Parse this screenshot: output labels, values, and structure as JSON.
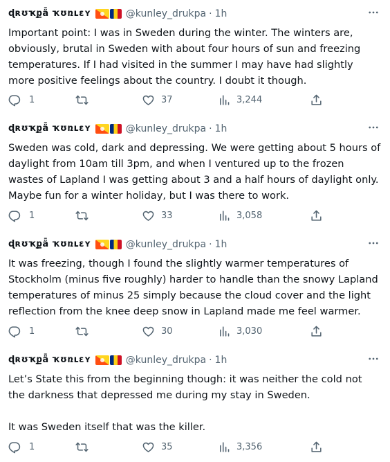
{
  "tweets": [
    {
      "display_name": "ɖʀʊҡքǟ ҡʊռʟɛʏ",
      "flags": [
        "bhutan-flag",
        "romania-flag"
      ],
      "handle": "@kunley_drukpa",
      "separator": "·",
      "time": "1h",
      "text": "Important point: I was in Sweden during the winter. The winters are, obviously, brutal in Sweden with about four hours of sun and freezing temperatures. If I had visited in the summer I may have had slightly more positive feelings about the country. I doubt it though.",
      "replies": "1",
      "retweets": "",
      "likes": "37",
      "views": "3,244"
    },
    {
      "display_name": "ɖʀʊҡքǟ ҡʊռʟɛʏ",
      "flags": [
        "bhutan-flag",
        "romania-flag"
      ],
      "handle": "@kunley_drukpa",
      "separator": "·",
      "time": "1h",
      "text": "Sweden was cold, dark and depressing. We were getting about 5 hours of daylight from 10am till 3pm, and when I ventured up to the frozen wastes of Lapland I was getting about 3 and a half hours of daylight only. Maybe fun for a winter holiday, but I was there to work.",
      "replies": "1",
      "retweets": "",
      "likes": "33",
      "views": "3,058"
    },
    {
      "display_name": "ɖʀʊҡքǟ ҡʊռʟɛʏ",
      "flags": [
        "bhutan-flag",
        "romania-flag"
      ],
      "handle": "@kunley_drukpa",
      "separator": "·",
      "time": "1h",
      "text": "It was freezing, though I found the slightly warmer temperatures of Stockholm (minus five roughly) harder to handle than the snowy Lapland temperatures of minus 25 simply because the cloud cover and the light reflection from the knee deep snow in Lapland made me feel warmer.",
      "replies": "1",
      "retweets": "",
      "likes": "30",
      "views": "3,030"
    },
    {
      "display_name": "ɖʀʊҡքǟ ҡʊռʟɛʏ",
      "flags": [
        "bhutan-flag",
        "romania-flag"
      ],
      "handle": "@kunley_drukpa",
      "separator": "·",
      "time": "1h",
      "text": "Let’s State this from the beginning though: it was neither the cold not the darkness that depressed me during my stay in Sweden.\n\nIt was Sweden itself that was the killer.",
      "replies": "1",
      "retweets": "",
      "likes": "35",
      "views": "3,356"
    }
  ],
  "colors": {
    "text": "#0f1419",
    "secondary": "#536471",
    "background": "#ffffff"
  }
}
